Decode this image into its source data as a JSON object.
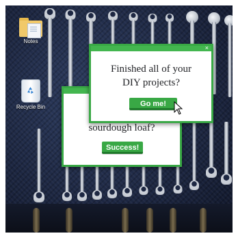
{
  "desktop": {
    "icons": [
      {
        "name": "notes",
        "label": "Notes",
        "icon": "folder-icon"
      },
      {
        "name": "recycle-bin",
        "label": "Recycle Bin",
        "icon": "recycle-bin-icon"
      }
    ]
  },
  "back_dialog": {
    "message_line": "sourdough loaf?",
    "button_label": "Success!"
  },
  "front_dialog": {
    "message_line_1": "Finished all of your",
    "message_line_2": "DIY projects?",
    "button_label": "Go me!",
    "close_label": "×"
  },
  "colors": {
    "accent": "#39a845",
    "titlebar": "#43b64f",
    "wallpaper": "#1d2742"
  }
}
